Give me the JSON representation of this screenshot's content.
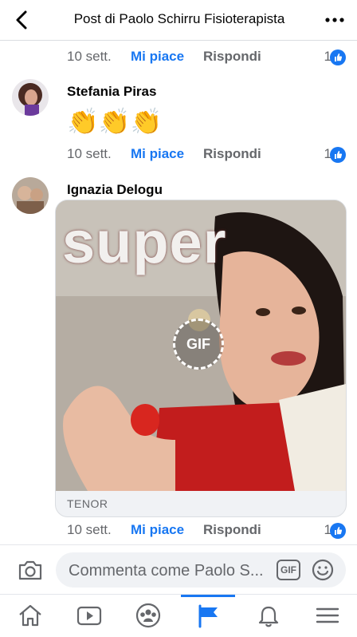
{
  "header": {
    "title": "Post di Paolo Schirru Fisioterapista",
    "back_icon": "back-arrow-icon",
    "more_icon": "more-horizontal-icon"
  },
  "comments": [
    {
      "meta": {
        "time": "10 sett.",
        "like": "Mi piace",
        "reply": "Rispondi",
        "likes": "1"
      }
    },
    {
      "author": "Stefania Piras",
      "text": "👏👏👏",
      "meta": {
        "time": "10 sett.",
        "like": "Mi piace",
        "reply": "Rispondi",
        "likes": "1"
      }
    },
    {
      "author": "Ignazia Delogu",
      "gif": {
        "caption": "super",
        "badge": "GIF",
        "source": "TENOR"
      },
      "meta": {
        "time": "10 sett.",
        "like": "Mi piace",
        "reply": "Rispondi",
        "likes": "1"
      }
    }
  ],
  "composer": {
    "placeholder": "Commenta come Paolo S...",
    "gif_label": "GIF",
    "camera_icon": "camera-icon",
    "emoji_icon": "emoji-icon"
  },
  "nav": {
    "items": [
      "home-icon",
      "video-icon",
      "groups-icon",
      "pages-flag-icon",
      "notifications-bell-icon",
      "menu-icon"
    ],
    "active": "pages-flag-icon"
  },
  "colors": {
    "accent": "#1877f2",
    "muted": "#65676b"
  }
}
